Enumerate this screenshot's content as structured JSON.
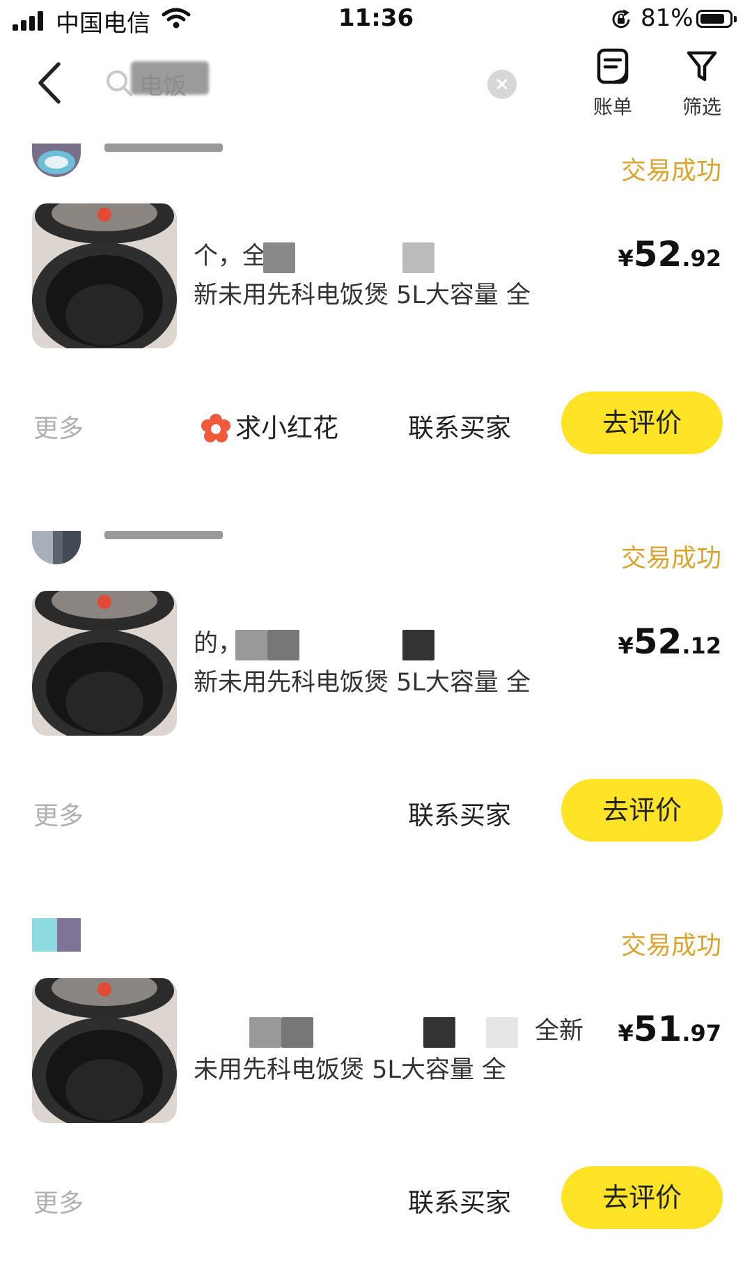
{
  "status_bar": {
    "carrier": "中国电信",
    "time": "11:36",
    "battery_pct": "81%",
    "battery_level": 0.81
  },
  "header": {
    "search_query": "电饭",
    "bill_label": "账单",
    "filter_label": "筛选"
  },
  "orders": [
    {
      "status": "交易成功",
      "title_line1": "个，全",
      "title_line2": "新未用先科电饭煲 5L大容量 全",
      "price_int": "52",
      "price_dec": ".92",
      "more_label": "更多",
      "flower_label": "求小红花",
      "contact_label": "联系买家",
      "review_label": "去评价"
    },
    {
      "status": "交易成功",
      "title_line1": "的，全",
      "title_line2": "新未用先科电饭煲 5L大容量 全",
      "price_int": "52",
      "price_dec": ".12",
      "more_label": "更多",
      "contact_label": "联系买家",
      "review_label": "去评价"
    },
    {
      "status": "交易成功",
      "title_line1": "全新",
      "title_line2": "未用先科电饭煲 5L大容量 全",
      "price_int": "51",
      "price_dec": ".97",
      "more_label": "更多",
      "contact_label": "联系买家",
      "review_label": "去评价"
    }
  ],
  "colors": {
    "accent_yellow": "#ffe326",
    "status_gold": "#d8a531",
    "muted_gray": "#b0b0b0",
    "flower_red": "#f05a3c"
  },
  "icons": {
    "currency": "¥"
  }
}
